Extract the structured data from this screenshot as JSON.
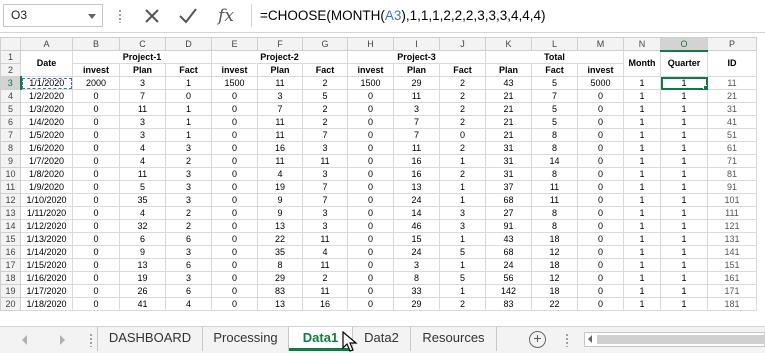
{
  "namebox": "O3",
  "formula": {
    "prefix": "=CHOOSE(MONTH(",
    "ref": "A3",
    "suffix": "),1,1,1,2,2,2,3,3,3,4,4,4)"
  },
  "icons": {
    "cancel": "cancel-x-icon",
    "enter": "checkmark-icon",
    "function": "fx-icon"
  },
  "columns": [
    "A",
    "B",
    "C",
    "D",
    "E",
    "F",
    "G",
    "H",
    "I",
    "J",
    "K",
    "L",
    "M",
    "N",
    "O",
    "P"
  ],
  "header_row1": {
    "date": "Date",
    "project1": "Project-1",
    "project2": "Project-2",
    "project3": "Project-3",
    "total": "Total",
    "month": "Month",
    "quarter": "Quarter",
    "id": "ID"
  },
  "header_row2": [
    "invest",
    "Plan",
    "Fact",
    "invest",
    "Plan",
    "Fact",
    "invest",
    "Plan",
    "Fact",
    "Plan",
    "Fact",
    "invest"
  ],
  "rows": [
    [
      "3",
      "1/1/2020",
      "2000",
      "3",
      "1",
      "1500",
      "11",
      "2",
      "1500",
      "29",
      "2",
      "43",
      "5",
      "5000",
      "1",
      "1",
      "11"
    ],
    [
      "4",
      "1/2/2020",
      "0",
      "7",
      "0",
      "0",
      "3",
      "5",
      "0",
      "11",
      "2",
      "21",
      "7",
      "0",
      "1",
      "1",
      "21"
    ],
    [
      "5",
      "1/3/2020",
      "0",
      "11",
      "1",
      "0",
      "7",
      "2",
      "0",
      "3",
      "2",
      "21",
      "5",
      "0",
      "1",
      "1",
      "31"
    ],
    [
      "6",
      "1/4/2020",
      "0",
      "3",
      "1",
      "0",
      "11",
      "2",
      "0",
      "7",
      "2",
      "21",
      "5",
      "0",
      "1",
      "1",
      "41"
    ],
    [
      "7",
      "1/5/2020",
      "0",
      "3",
      "1",
      "0",
      "11",
      "7",
      "0",
      "7",
      "0",
      "21",
      "8",
      "0",
      "1",
      "1",
      "51"
    ],
    [
      "8",
      "1/6/2020",
      "0",
      "4",
      "3",
      "0",
      "16",
      "3",
      "0",
      "11",
      "2",
      "31",
      "8",
      "0",
      "1",
      "1",
      "61"
    ],
    [
      "9",
      "1/7/2020",
      "0",
      "4",
      "2",
      "0",
      "11",
      "11",
      "0",
      "16",
      "1",
      "31",
      "14",
      "0",
      "1",
      "1",
      "71"
    ],
    [
      "10",
      "1/8/2020",
      "0",
      "11",
      "3",
      "0",
      "4",
      "3",
      "0",
      "16",
      "2",
      "31",
      "8",
      "0",
      "1",
      "1",
      "81"
    ],
    [
      "11",
      "1/9/2020",
      "0",
      "5",
      "3",
      "0",
      "19",
      "7",
      "0",
      "13",
      "1",
      "37",
      "11",
      "0",
      "1",
      "1",
      "91"
    ],
    [
      "12",
      "1/10/2020",
      "0",
      "35",
      "3",
      "0",
      "9",
      "7",
      "0",
      "24",
      "1",
      "68",
      "11",
      "0",
      "1",
      "1",
      "101"
    ],
    [
      "13",
      "1/11/2020",
      "0",
      "4",
      "2",
      "0",
      "9",
      "3",
      "0",
      "14",
      "3",
      "27",
      "8",
      "0",
      "1",
      "1",
      "111"
    ],
    [
      "14",
      "1/12/2020",
      "0",
      "32",
      "2",
      "0",
      "13",
      "3",
      "0",
      "46",
      "3",
      "91",
      "8",
      "0",
      "1",
      "1",
      "121"
    ],
    [
      "15",
      "1/13/2020",
      "0",
      "6",
      "6",
      "0",
      "22",
      "11",
      "0",
      "15",
      "1",
      "43",
      "18",
      "0",
      "1",
      "1",
      "131"
    ],
    [
      "16",
      "1/14/2020",
      "0",
      "9",
      "3",
      "0",
      "35",
      "4",
      "0",
      "24",
      "5",
      "68",
      "12",
      "0",
      "1",
      "1",
      "141"
    ],
    [
      "17",
      "1/15/2020",
      "0",
      "13",
      "6",
      "0",
      "8",
      "11",
      "0",
      "3",
      "1",
      "24",
      "18",
      "0",
      "1",
      "1",
      "151"
    ],
    [
      "18",
      "1/16/2020",
      "0",
      "19",
      "3",
      "0",
      "29",
      "2",
      "0",
      "8",
      "5",
      "56",
      "12",
      "0",
      "1",
      "1",
      "161"
    ],
    [
      "19",
      "1/17/2020",
      "0",
      "26",
      "6",
      "0",
      "83",
      "11",
      "0",
      "33",
      "1",
      "142",
      "18",
      "0",
      "1",
      "1",
      "171"
    ],
    [
      "20",
      "1/18/2020",
      "0",
      "41",
      "4",
      "0",
      "13",
      "16",
      "0",
      "29",
      "2",
      "83",
      "22",
      "0",
      "1",
      "1",
      "181"
    ]
  ],
  "sheet_tabs": [
    "DASHBOARD",
    "Processing",
    "Data1",
    "Data2",
    "Resources"
  ],
  "active_tab": "Data1",
  "colors": {
    "excel_green": "#107c41",
    "ref_blue": "#4472c4"
  }
}
